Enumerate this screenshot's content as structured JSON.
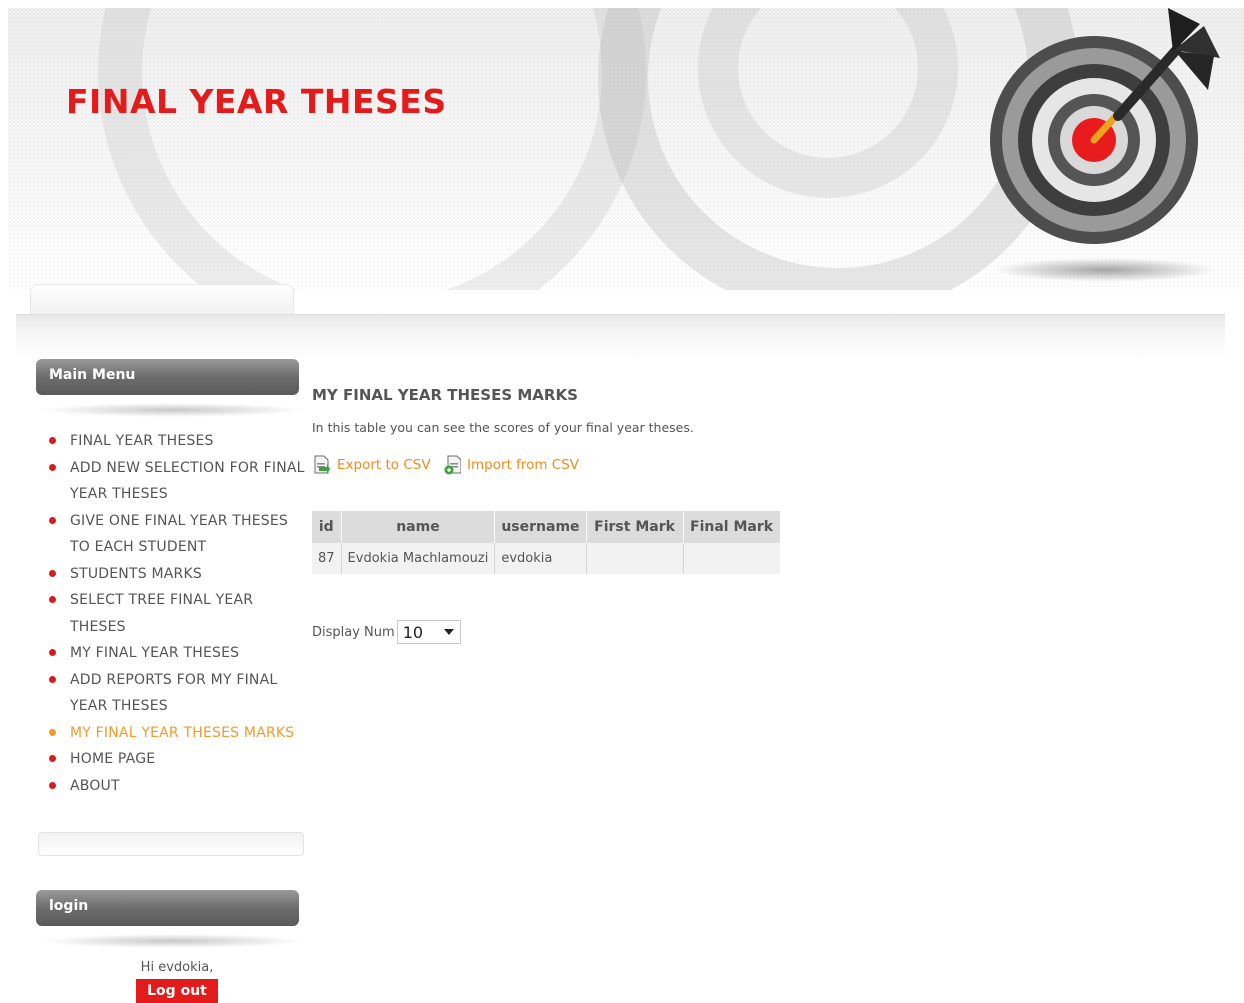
{
  "site": {
    "title": "FINAL YEAR THESES"
  },
  "main_menu": {
    "title": "Main Menu",
    "items": [
      {
        "label": "FINAL YEAR THESES",
        "active": false
      },
      {
        "label": "ADD NEW SELECTION FOR FINAL YEAR THESES",
        "active": false
      },
      {
        "label": "GIVE ONE FINAL YEAR THESES TO EACH STUDENT",
        "active": false
      },
      {
        "label": "STUDENTS MARKS",
        "active": false
      },
      {
        "label": "SELECT TREE FINAL YEAR THESES",
        "active": false
      },
      {
        "label": "MY FINAL YEAR THESES",
        "active": false
      },
      {
        "label": "ADD REPORTS FOR MY FINAL YEAR THESES",
        "active": false
      },
      {
        "label": "MY FINAL YEAR THESES MARKS",
        "active": true
      },
      {
        "label": "HOME PAGE",
        "active": false
      },
      {
        "label": "ABOUT",
        "active": false
      }
    ]
  },
  "login": {
    "title": "login",
    "greeting": "Hi evdokia,",
    "logout_label": "Log out"
  },
  "content": {
    "title": "MY FINAL YEAR THESES MARKS",
    "description": "In this table you can see the scores of your final year theses.",
    "export_label": "Export to CSV",
    "import_label": "Import from CSV",
    "table": {
      "headers": [
        "id",
        "name",
        "username",
        "First Mark",
        "Final Mark"
      ],
      "rows": [
        [
          "87",
          "Evdokia Machlamouzi",
          "evdokia",
          "",
          ""
        ]
      ]
    },
    "display_num_label": "Display Num",
    "display_num_value": "10"
  },
  "colors": {
    "brand_red": "#e31b1b",
    "active_orange": "#f39a2e",
    "link_orange": "#f08a1c",
    "module_grey": "#6d6d6d"
  },
  "icons": {
    "bullet": "bullet-dot-icon",
    "export": "csv-export-icon",
    "import": "csv-import-icon",
    "logo": "target-dart-icon",
    "select_caret": "chevron-down-icon"
  }
}
